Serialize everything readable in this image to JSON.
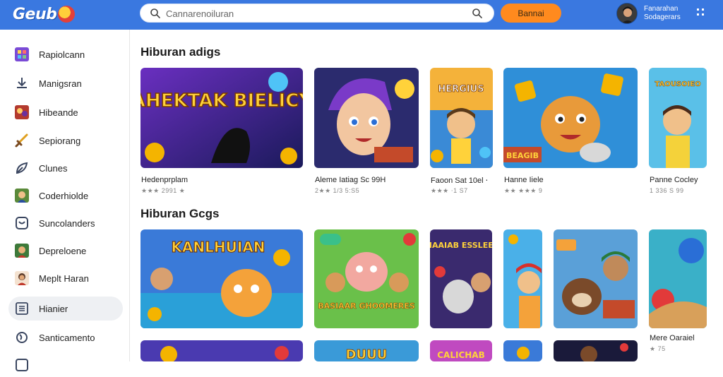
{
  "header": {
    "logo_text": "Geub",
    "search_placeholder": "Cannarenoiluran",
    "cta_label": "Bannai",
    "user_name": "Fanarahan",
    "user_sub": "Sodagerars"
  },
  "sidebar": {
    "items": [
      {
        "label": "Rapiolcann",
        "icon": "apps-grid-icon"
      },
      {
        "label": "Manigsran",
        "icon": "download-icon"
      },
      {
        "label": "Hibeande",
        "icon": "game-thumb-icon"
      },
      {
        "label": "Sepiorang",
        "icon": "sword-icon"
      },
      {
        "label": "Clunes",
        "icon": "leaf-icon"
      },
      {
        "label": "Coderhiolde",
        "icon": "character-thumb-icon"
      },
      {
        "label": "Suncolanders",
        "icon": "shield-icon"
      },
      {
        "label": "Depreloene",
        "icon": "avatar-thumb-icon"
      },
      {
        "label": "Meplt Haran",
        "icon": "person-thumb-icon"
      },
      {
        "label": "Hianier",
        "icon": "list-icon",
        "active": true
      },
      {
        "label": "Santicamento",
        "icon": "globe-icon"
      }
    ]
  },
  "sections": [
    {
      "title": "Hiburan adigs",
      "cards": [
        {
          "thumb_text": "AHEKTAK BIELICY",
          "title": "Hedenprplam",
          "meta": "★★★ 2991 ★"
        },
        {
          "thumb_text": "",
          "title": "Aleme Iatiag Sc 99H",
          "meta": "2★★ 1/3 5:S5"
        },
        {
          "thumb_text": "HERGIUS",
          "title": "Faoon Sat 10el ⋅",
          "meta": "★★★ ⋅1 S7"
        },
        {
          "thumb_text": "BEAGIB",
          "title": "Hanne Iiele",
          "meta": "★★ ★★★ 9"
        },
        {
          "thumb_text": "TAOUSOIEO",
          "title": "Panne Cocley",
          "meta": "1 336 S 99"
        }
      ]
    },
    {
      "title": "Hiburan Gcgs",
      "cards": [
        {
          "thumb_text": "KANLHUIAN",
          "title": "",
          "meta": ""
        },
        {
          "thumb_text": "BASIAAR GHOOMERES",
          "title": "",
          "meta": ""
        },
        {
          "thumb_text": "KIAAIAB ESSLEES",
          "title": "",
          "meta": ""
        },
        {
          "thumb_text": "",
          "title": "",
          "meta": ""
        },
        {
          "thumb_text": "",
          "title": "",
          "meta": ""
        },
        {
          "thumb_text": "",
          "title": "Mere Oaraiel",
          "meta": "★ 75"
        }
      ]
    },
    {
      "cards": [
        {
          "thumb_text": ""
        },
        {
          "thumb_text": "DUUU"
        },
        {
          "thumb_text": "CALICHAB"
        },
        {
          "thumb_text": ""
        },
        {
          "thumb_text": ""
        }
      ]
    }
  ],
  "colors": {
    "header_bg": "#3a78e0",
    "cta_bg": "#ff8a1e",
    "active_item_bg": "#eef0f3"
  }
}
